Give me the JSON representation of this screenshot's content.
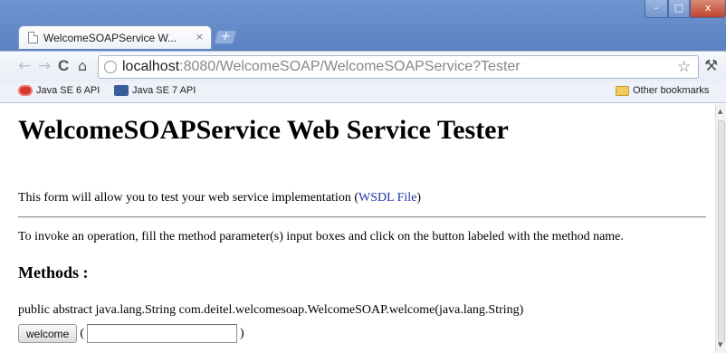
{
  "browser": {
    "tab_title": "WelcomeSOAPService W...",
    "tab_close": "×",
    "new_tab": "+",
    "window_controls": {
      "minimize": "–",
      "maximize": "□",
      "close": "x"
    },
    "url_host": "localhost",
    "url_path": ":8080/WelcomeSOAP/WelcomeSOAPService?Tester",
    "icons": [
      "back-icon",
      "forward-icon",
      "reload-icon",
      "home-icon",
      "globe-icon",
      "star-icon",
      "wrench-icon"
    ]
  },
  "bookmarks": {
    "items": [
      {
        "label": "Java SE 6 API"
      },
      {
        "label": "Java SE 7 API"
      }
    ],
    "other_label": "Other bookmarks"
  },
  "page": {
    "title": "WelcomeSOAPService Web Service Tester",
    "intro_text": "This form will allow you to test your web service implementation (",
    "wsdl_link": "WSDL File",
    "intro_close": ")",
    "instructions": "To invoke an operation, fill the method parameter(s) input boxes and click on the button labeled with the method name.",
    "methods_heading": "Methods :",
    "signature": "public abstract java.lang.String com.deitel.welcomesoap.WelcomeSOAP.welcome(java.lang.String)",
    "method_button": "welcome",
    "paren_open": "(",
    "paren_close": ")",
    "param_value": ""
  },
  "colors": {
    "titlebar": "#6f95cf",
    "link": "#2233aa"
  }
}
